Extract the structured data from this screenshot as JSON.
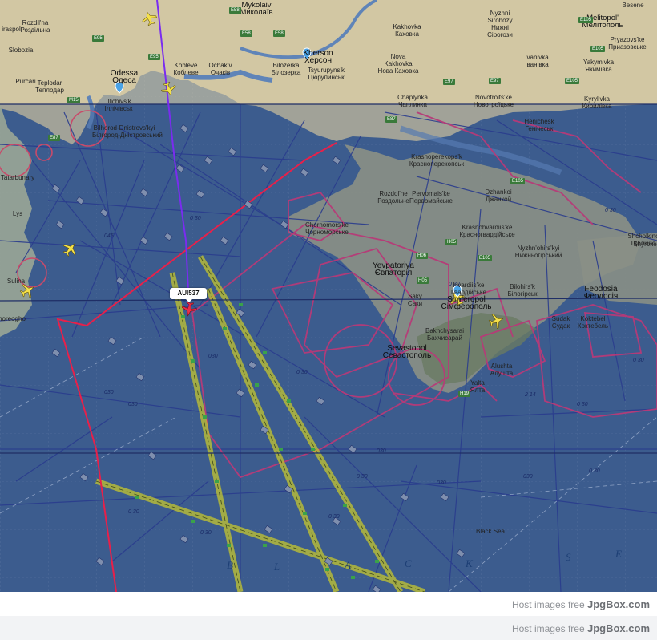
{
  "map": {
    "flight": {
      "callsign": "AUI537"
    },
    "places": [
      {
        "id": "mykolaiv",
        "lines": [
          "Mykolaiv",
          "Миколаїв"
        ]
      },
      {
        "id": "beseme",
        "lines": [
          "Besene"
        ]
      },
      {
        "id": "melitopol",
        "lines": [
          "Melitopol'",
          "Мелітополь"
        ]
      },
      {
        "id": "tiraspol",
        "lines": [
          "iraspol"
        ]
      },
      {
        "id": "rozdilna",
        "lines": [
          "Rozdil'na",
          "Роздільна"
        ]
      },
      {
        "id": "slobozia",
        "lines": [
          "Slobozia"
        ]
      },
      {
        "id": "purcari",
        "lines": [
          "Purcari"
        ]
      },
      {
        "id": "teplodar",
        "lines": [
          "Teplodar",
          "Теплодар"
        ]
      },
      {
        "id": "odessa",
        "lines": [
          "Odessa",
          "Одеса"
        ]
      },
      {
        "id": "kobleve",
        "lines": [
          "Kobleve",
          "Коблеве"
        ]
      },
      {
        "id": "ochakiv",
        "lines": [
          "Ochakiv",
          "Очаків"
        ]
      },
      {
        "id": "bilozerka",
        "lines": [
          "Bilozerka",
          "Білозерка"
        ]
      },
      {
        "id": "kherson",
        "lines": [
          "Kherson",
          "Херсон"
        ]
      },
      {
        "id": "tsyurupynsk",
        "lines": [
          "Tsyurupyns'k",
          "Цюрупинськ"
        ]
      },
      {
        "id": "kakhovka",
        "lines": [
          "Kakhovka",
          "Каховка"
        ]
      },
      {
        "id": "nova-kakhovka",
        "lines": [
          "Nova",
          "Kakhovka",
          "Нова Каховка"
        ]
      },
      {
        "id": "nyzhni-sirohozy",
        "lines": [
          "Nyzhni",
          "Sirohozy",
          "Нижні",
          "Сірогози"
        ]
      },
      {
        "id": "ivanivka",
        "lines": [
          "Ivanivka",
          "Іванівка"
        ]
      },
      {
        "id": "pryazovske",
        "lines": [
          "Pryazovs'ke",
          "Приазовське"
        ]
      },
      {
        "id": "yakymivka",
        "lines": [
          "Yakymivka",
          "Якимівка"
        ]
      },
      {
        "id": "illichivsk",
        "lines": [
          "Illichivs'k",
          "Іллічівськ"
        ]
      },
      {
        "id": "chaplynka",
        "lines": [
          "Chaplynka",
          "Чаплинка"
        ]
      },
      {
        "id": "novotroitske",
        "lines": [
          "Novotroits'ke",
          "Новотроїцьке"
        ]
      },
      {
        "id": "kyrylivka",
        "lines": [
          "Kyrylivka",
          "Кирилівка"
        ]
      },
      {
        "id": "bilhorod",
        "lines": [
          "Bilhorod-Dnistrovs'kyi",
          "Білгород-Дністровський"
        ]
      },
      {
        "id": "henichesk",
        "lines": [
          "Henichesk",
          "Генічеськ"
        ]
      },
      {
        "id": "krasnoperekopsk",
        "lines": [
          "Krasnoperekops'k",
          "Красноперекопськ"
        ]
      },
      {
        "id": "rozdolne",
        "lines": [
          "Rozdol'ne",
          "Роздольне"
        ]
      },
      {
        "id": "pervomaiske",
        "lines": [
          "Pervomais'ke",
          "Первомайське"
        ]
      },
      {
        "id": "dzhankoi",
        "lines": [
          "Dzhankoi",
          "Джанкой"
        ]
      },
      {
        "id": "chornomorske",
        "lines": [
          "Chornomors'ke",
          "Чорноморське"
        ]
      },
      {
        "id": "krasnohvardiiske",
        "lines": [
          "Krasnohvardiis'ke",
          "Красногвардійське"
        ]
      },
      {
        "id": "nyzhnohirskyi",
        "lines": [
          "Nyzhn'ohirs'kyi",
          "Нижньогірський"
        ]
      },
      {
        "id": "yevpatoriya",
        "lines": [
          "Yevpatoriya",
          "Євпаторія"
        ]
      },
      {
        "id": "hvardiiske",
        "lines": [
          "Hvardiis'ke",
          "Гвардійське"
        ]
      },
      {
        "id": "simferopol",
        "lines": [
          "Simferopol",
          "Сімферополь"
        ]
      },
      {
        "id": "bilohirsk",
        "lines": [
          "Bilohirs'k",
          "Білогірськ"
        ]
      },
      {
        "id": "feodosia",
        "lines": [
          "Feodosia",
          "Феодосія"
        ]
      },
      {
        "id": "shchelkino",
        "lines": [
          "Shcholkino",
          "Щолкіно"
        ]
      },
      {
        "id": "saky",
        "lines": [
          "Saky",
          "Саки"
        ]
      },
      {
        "id": "bakhchysarai",
        "lines": [
          "Bakhchysarai",
          "Бахчисарай"
        ]
      },
      {
        "id": "sevastopol",
        "lines": [
          "Sevastopol",
          "Севастополь"
        ]
      },
      {
        "id": "sudak",
        "lines": [
          "Sudak",
          "Судак"
        ]
      },
      {
        "id": "koktebel",
        "lines": [
          "Koktebel",
          "Коктебель"
        ]
      },
      {
        "id": "yalta",
        "lines": [
          "Yalta",
          "Ялта"
        ]
      },
      {
        "id": "alushta",
        "lines": [
          "Alushta",
          "Алушта"
        ]
      },
      {
        "id": "sulina",
        "lines": [
          "Sulina"
        ]
      },
      {
        "id": "lys",
        "lines": [
          "Lys"
        ]
      },
      {
        "id": "horeogho",
        "lines": [
          "horeogho"
        ]
      },
      {
        "id": "black-sea",
        "lines": [
          "Black Sea"
        ]
      },
      {
        "id": "shyroke",
        "lines": [
          "Shyroke"
        ]
      },
      {
        "id": "ukraine-text",
        "lines": [
          "Tatarbunary"
        ]
      }
    ],
    "roads": [
      "E58",
      "E58",
      "E95",
      "E95",
      "E87",
      "E105",
      "E105",
      "E97",
      "E97",
      "E105",
      "H05",
      "H06",
      "E105",
      "H19",
      "M15",
      "E87",
      "E58",
      "E105",
      "H05"
    ],
    "sea_letters": [
      "B",
      "L",
      "A",
      "C",
      "K",
      "S",
      "E"
    ],
    "fl_labels": [
      "045",
      "0 30",
      "030",
      "0 30",
      "030",
      "0 30",
      "0 30",
      "030",
      "0 30",
      "0 30",
      "030",
      "030",
      "0 30",
      "0 30",
      "2 14",
      "0 30",
      "0 30",
      "0 30",
      "030"
    ]
  },
  "footer": {
    "rows": [
      {
        "prefix": "Host images free ",
        "brand": "JpgBox.com"
      },
      {
        "prefix": "Host images free ",
        "brand": "JpgBox.com"
      }
    ]
  },
  "colors": {
    "sea": "#3f5f8f",
    "land": "#d6c9a4",
    "route_red": "#e8204a",
    "route_purple": "#7a2cf0",
    "airway": "#c4c62e",
    "airspace": "#b73a78"
  }
}
